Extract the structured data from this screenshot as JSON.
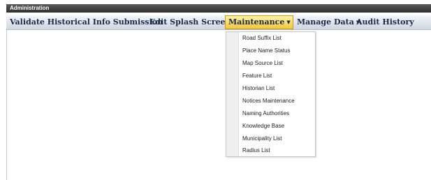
{
  "window": {
    "title": "Administration"
  },
  "menu": {
    "validate": "Validate Historical Info Submission",
    "splash": "Edit Splash Screen",
    "maintenance": "Maintenance",
    "manage_data": "Manage Data",
    "audit": "Audit History",
    "arrow": "▼"
  },
  "maintenance_menu": {
    "items": [
      "Road Suffix List",
      "Place Name Status",
      "Map Source List",
      "Feature List",
      "Historian List",
      "Notices Maintenance",
      "Naming Authorities",
      "Knowledge Base",
      "Municipality List",
      "Radius List"
    ]
  },
  "colors": {
    "title_bar": "#3a3a3a",
    "active_menu": "#f3c63e",
    "menu_text": "#1a2a4a"
  }
}
